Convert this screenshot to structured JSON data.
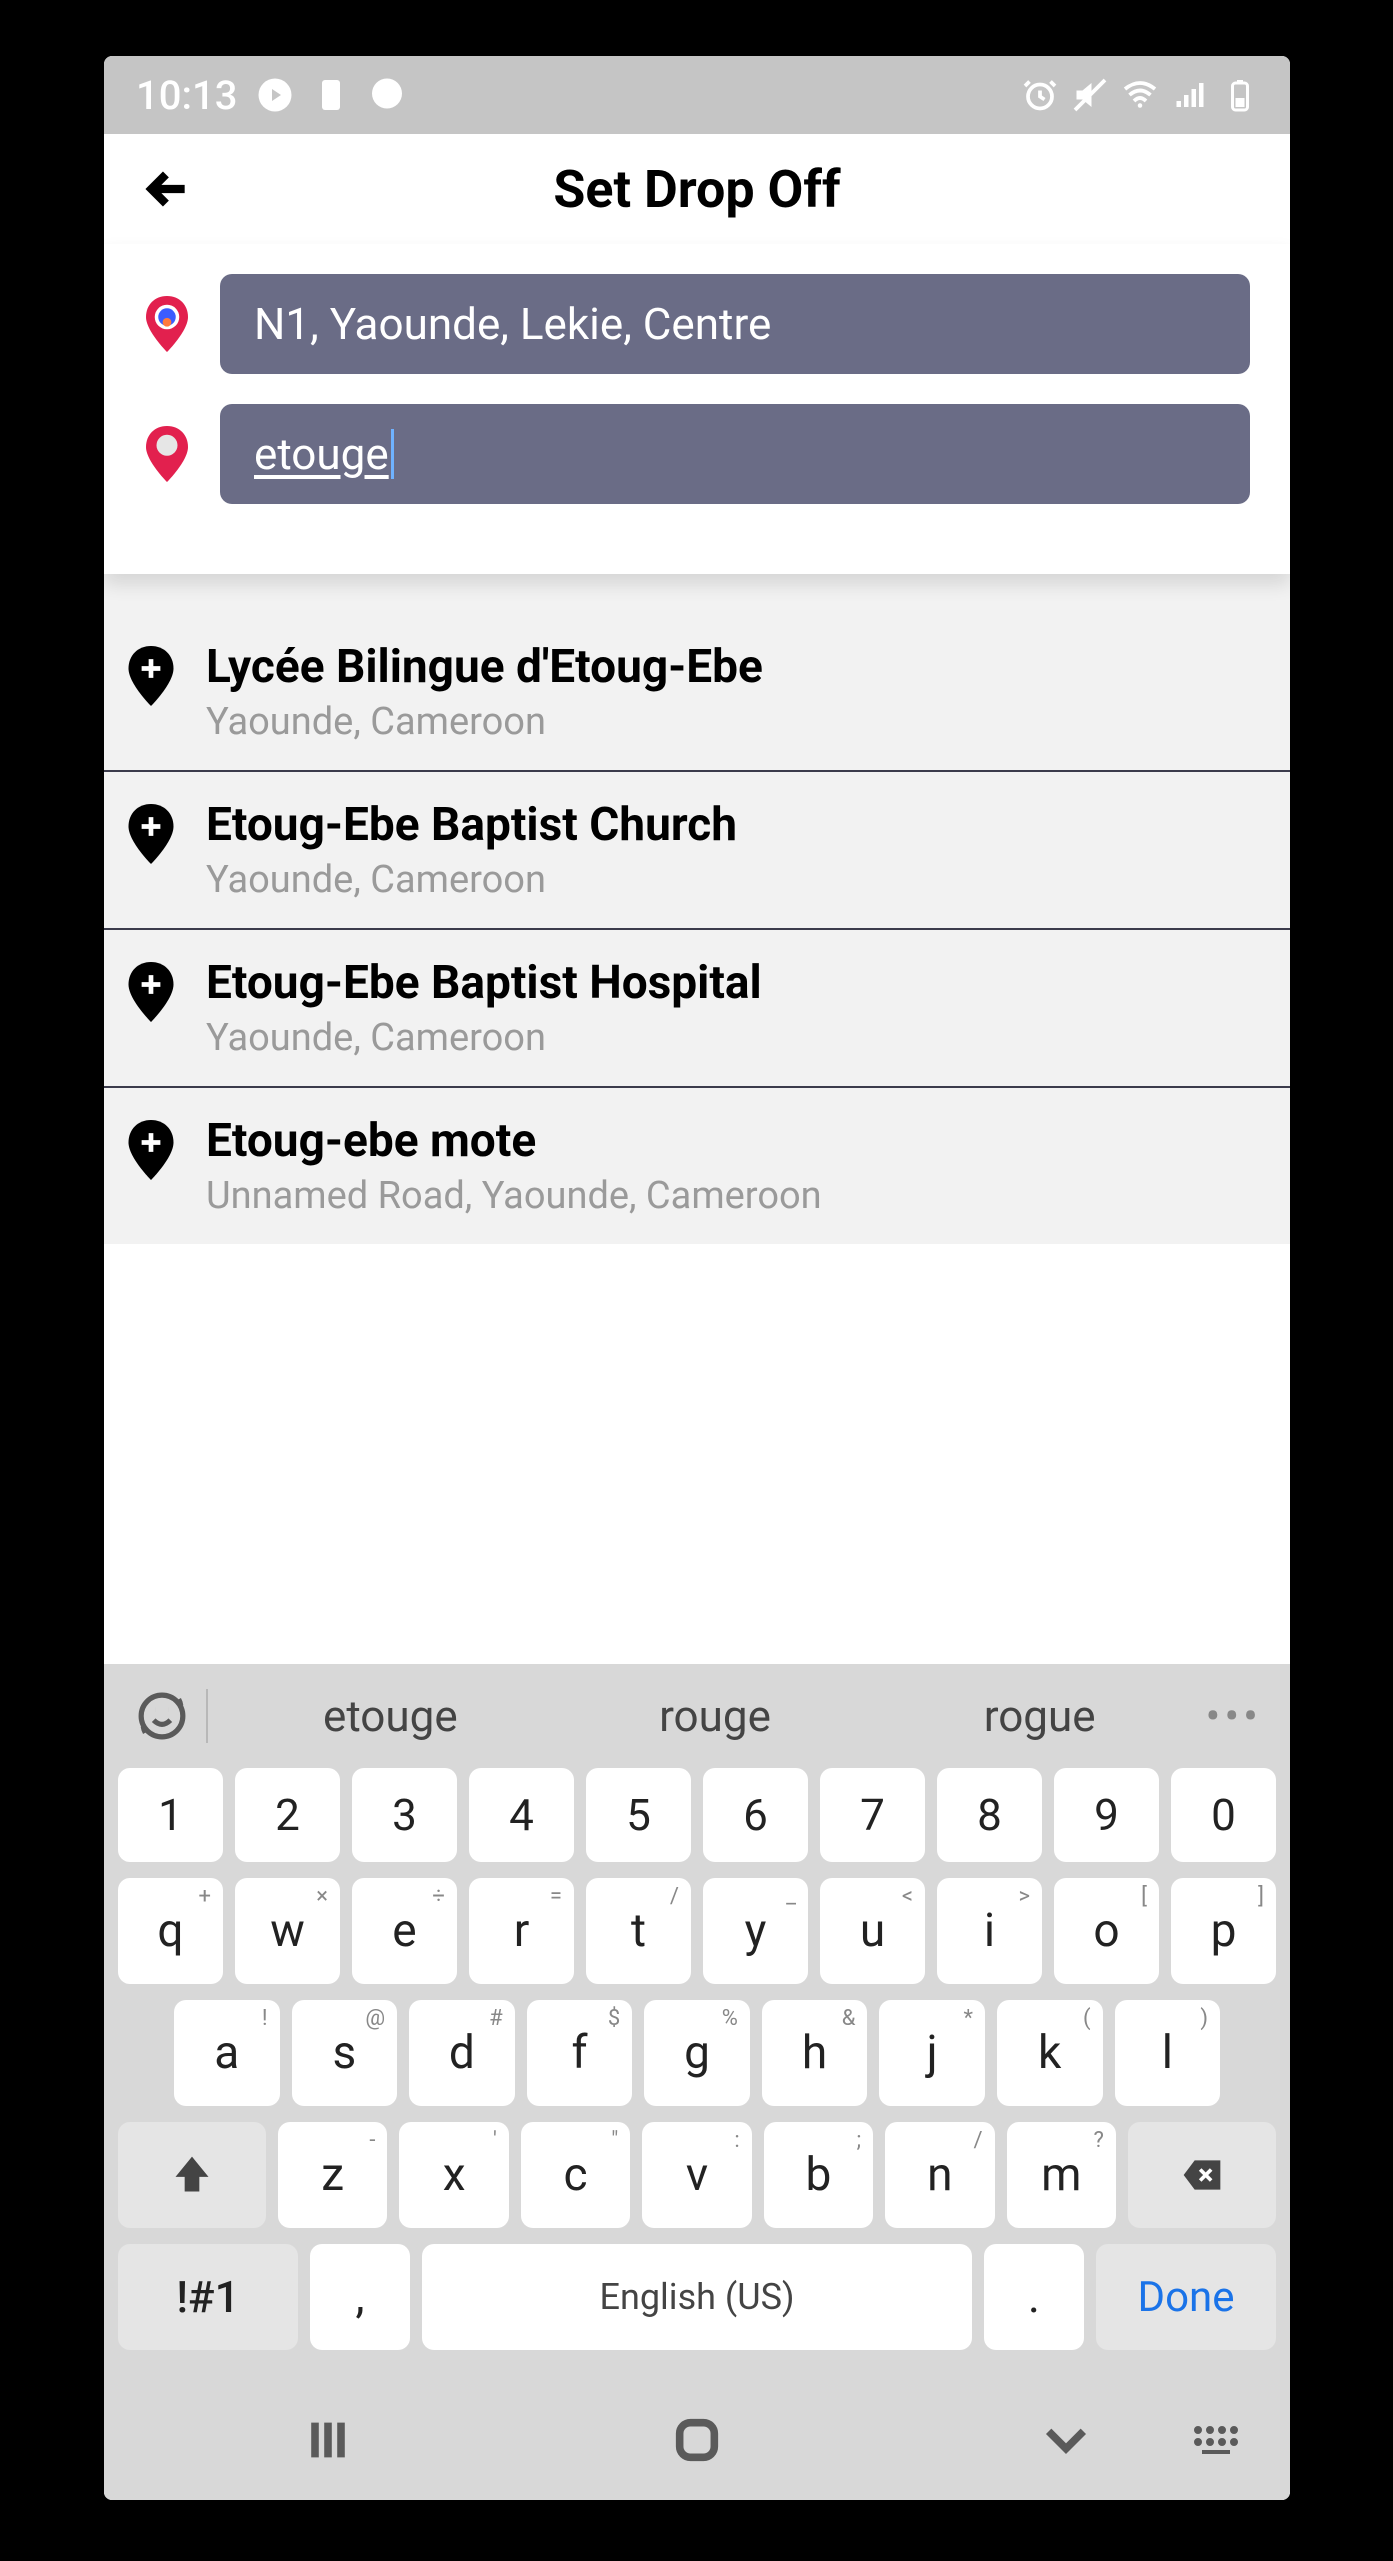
{
  "statusbar": {
    "time": "10:13"
  },
  "header": {
    "title": "Set Drop Off"
  },
  "inputs": {
    "origin": "N1, Yaounde, Lekie, Centre",
    "destination": "etouge"
  },
  "suggestions": [
    {
      "title": "Lycée Bilingue d'Etoug-Ebe",
      "subtitle": "Yaounde, Cameroon"
    },
    {
      "title": "Etoug-Ebe Baptist Church",
      "subtitle": "Yaounde, Cameroon"
    },
    {
      "title": "Etoug-Ebe Baptist Hospital",
      "subtitle": "Yaounde, Cameroon"
    },
    {
      "title": "Etoug-ebe mote",
      "subtitle": "Unnamed Road, Yaounde, Cameroon"
    }
  ],
  "keyboard": {
    "predictions": [
      "etouge",
      "rouge",
      "rogue"
    ],
    "row_num": [
      "1",
      "2",
      "3",
      "4",
      "5",
      "6",
      "7",
      "8",
      "9",
      "0"
    ],
    "row1": [
      {
        "k": "q",
        "s": "+"
      },
      {
        "k": "w",
        "s": "×"
      },
      {
        "k": "e",
        "s": "÷"
      },
      {
        "k": "r",
        "s": "="
      },
      {
        "k": "t",
        "s": "/"
      },
      {
        "k": "y",
        "s": "_"
      },
      {
        "k": "u",
        "s": "<"
      },
      {
        "k": "i",
        "s": ">"
      },
      {
        "k": "o",
        "s": "["
      },
      {
        "k": "p",
        "s": "]"
      }
    ],
    "row2": [
      {
        "k": "a",
        "s": "!"
      },
      {
        "k": "s",
        "s": "@"
      },
      {
        "k": "d",
        "s": "#"
      },
      {
        "k": "f",
        "s": "$"
      },
      {
        "k": "g",
        "s": "%"
      },
      {
        "k": "h",
        "s": "&"
      },
      {
        "k": "j",
        "s": "*"
      },
      {
        "k": "k",
        "s": "("
      },
      {
        "k": "l",
        "s": ")"
      }
    ],
    "row3": [
      {
        "k": "z",
        "s": "-"
      },
      {
        "k": "x",
        "s": "'"
      },
      {
        "k": "c",
        "s": "\""
      },
      {
        "k": "v",
        "s": ":"
      },
      {
        "k": "b",
        "s": ";"
      },
      {
        "k": "n",
        "s": "/"
      },
      {
        "k": "m",
        "s": "?"
      }
    ],
    "symbols_label": "!#1",
    "space_label": "English (US)",
    "done_label": "Done",
    "comma": ",",
    "period": "."
  }
}
